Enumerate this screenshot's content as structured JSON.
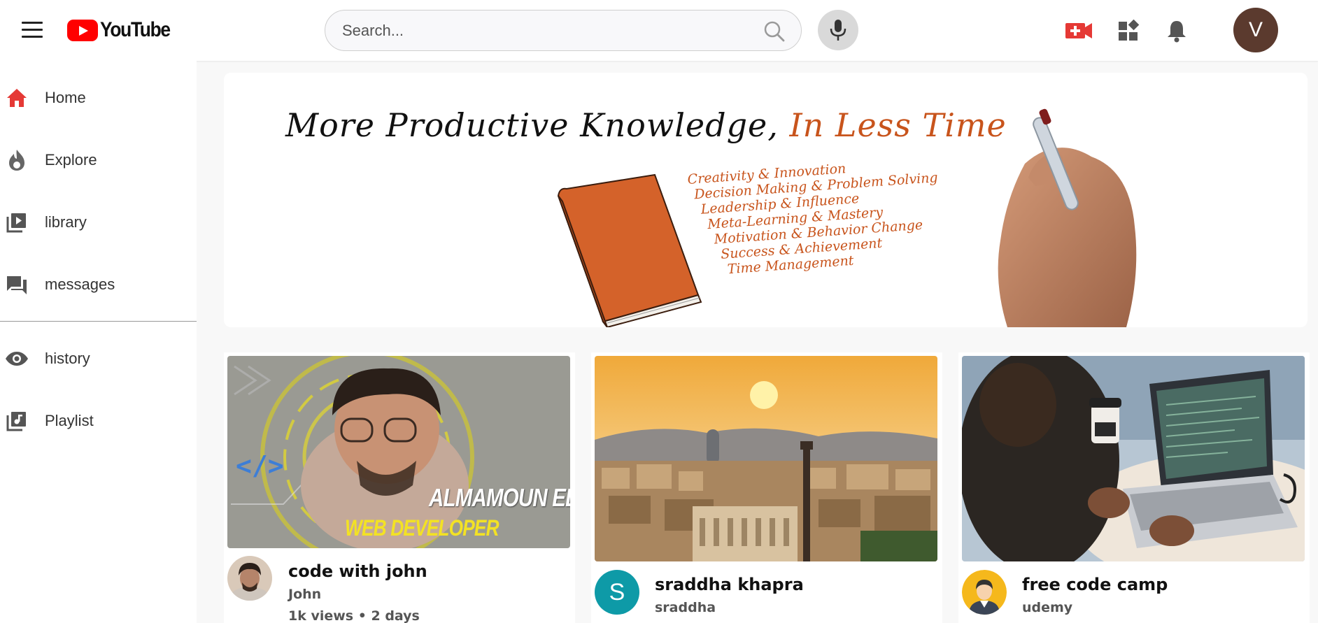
{
  "header": {
    "logo_text": "YouTube",
    "search_placeholder": "Search...",
    "avatar_letter": "V",
    "icons": [
      "menu-icon",
      "search-icon",
      "mic-icon",
      "create-video-icon",
      "apps-icon",
      "bell-icon"
    ],
    "brand_color": "#ff0000",
    "avatar_color": "#5b3a2e"
  },
  "sidebar": {
    "items": [
      {
        "label": "Home",
        "icon": "home-icon",
        "active": true
      },
      {
        "label": "Explore",
        "icon": "flame-icon"
      },
      {
        "label": "library",
        "icon": "library-icon"
      },
      {
        "label": "messages",
        "icon": "messages-icon"
      },
      {
        "label": "history",
        "icon": "eye-icon"
      },
      {
        "label": "Playlist",
        "icon": "playlist-icon"
      }
    ],
    "active_color": "#e53935"
  },
  "banner": {
    "title_part1": "More Productive Knowledge, ",
    "title_part2": "In Less Time",
    "skills": [
      "Creativity & Innovation",
      "Decision Making & Problem Solving",
      "Leadership & Influence",
      "Meta-Learning & Mastery",
      "Motivation & Behavior Change",
      "Success & Achievement",
      "Time Management"
    ],
    "accent_color": "#c8541c"
  },
  "videos": [
    {
      "title": "code with john",
      "channel": "John",
      "meta": "1k views • 2 days",
      "thumb_text_1": "ALMAMOUN EL",
      "thumb_text_2": "WEB DEVELOPER",
      "code_glyph": "</>"
    },
    {
      "title": "sraddha khapra",
      "channel": "sraddha",
      "avatar_letter": "S",
      "avatar_color": "#0e9aa7"
    },
    {
      "title": "free code camp",
      "channel": "udemy"
    }
  ]
}
